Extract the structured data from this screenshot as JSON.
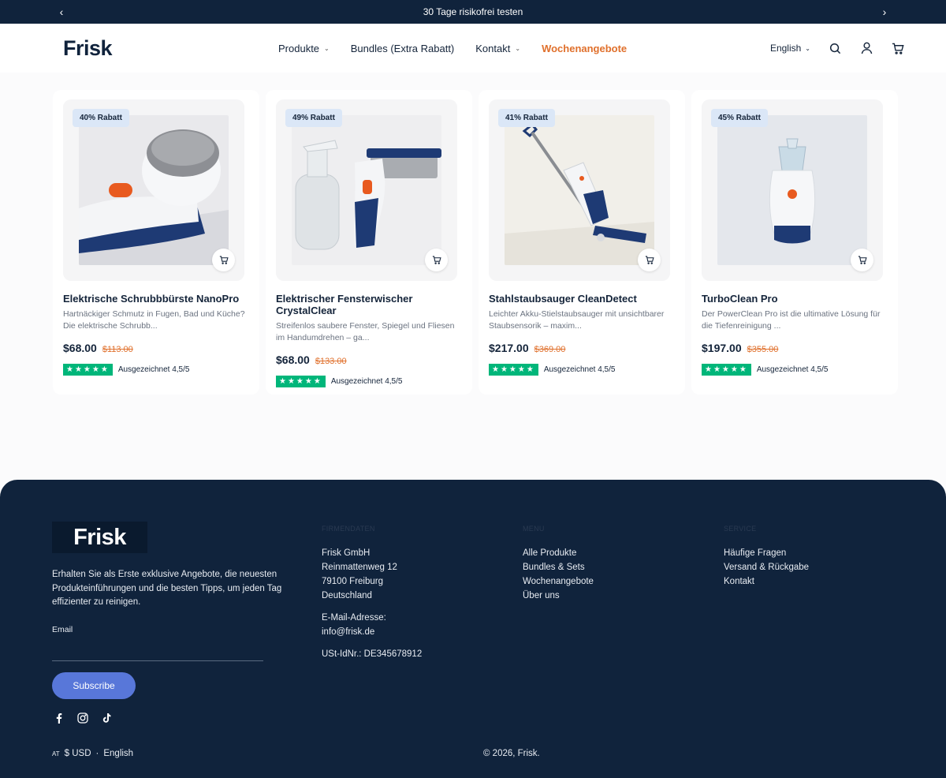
{
  "announcement": {
    "text": "30 Tage risikofrei testen",
    "prev": "‹",
    "next": "›"
  },
  "header": {
    "logo": "Frisk",
    "nav": [
      {
        "label": "Produkte",
        "chevron": "⌄"
      },
      {
        "label": "Bundles (Extra Rabatt)"
      },
      {
        "label": "Kontakt",
        "chevron": "⌄"
      },
      {
        "label": "Wochenangebote"
      }
    ],
    "language": "English",
    "language_chevron": "⌄"
  },
  "products": [
    {
      "badge": "40% Rabatt",
      "title": "Elektrische Schrubbbürste NanoPro",
      "desc": "Hartnäckiger Schmutz in Fugen, Bad und Küche? Die elektrische Schrubb...",
      "price": "$68.00",
      "old_price": "$113.00",
      "stars": "★★★★★",
      "rating": "Ausgezeichnet 4,5/5"
    },
    {
      "badge": "49% Rabatt",
      "title": "Elektrischer Fensterwischer CrystalClear",
      "desc": "Streifenlos saubere Fenster, Spiegel und Fliesen im Handumdrehen – ga...",
      "price": "$68.00",
      "old_price": "$133.00",
      "stars": "★★★★★",
      "rating": "Ausgezeichnet 4,5/5"
    },
    {
      "badge": "41% Rabatt",
      "title": "Stahlstaubsauger CleanDetect",
      "desc": "Leichter Akku-Stielstaubsauger mit unsichtbarer Staubsensorik – maxim...",
      "price": "$217.00",
      "old_price": "$369.00",
      "stars": "★★★★★",
      "rating": "Ausgezeichnet 4,5/5"
    },
    {
      "badge": "45% Rabatt",
      "title": "TurboClean Pro",
      "desc": "Der PowerClean Pro ist die ultimative Lösung für die Tiefenreinigung ...",
      "price": "$197.00",
      "old_price": "$355.00",
      "stars": "★★★★★",
      "rating": "Ausgezeichnet 4,5/5"
    }
  ],
  "footer": {
    "logo": "Frisk",
    "tagline": "Erhalten Sie als Erste exklusive Angebote, die neuesten Produkteinführungen und die besten Tipps, um jeden Tag effizienter zu reinigen.",
    "email_label": "Email",
    "subscribe": "Subscribe",
    "company": {
      "heading": "FIRMENDATEN",
      "lines": [
        "Frisk GmbH",
        "Reinmattenweg 12",
        "79100 Freiburg",
        "Deutschland"
      ],
      "email_label": "E-Mail-Adresse:",
      "email": "info@frisk.de",
      "vat": "USt-IdNr.: DE345678912"
    },
    "menu": {
      "heading": "MENU",
      "links": [
        "Alle Produkte",
        "Bundles & Sets",
        "Wochenangebote",
        "Über uns"
      ]
    },
    "service": {
      "heading": "SERVICE",
      "links": [
        "Häufige Fragen",
        "Versand & Rückgabe",
        "Kontakt"
      ]
    },
    "bottom": {
      "country": "AT",
      "currency": "$ USD",
      "separator": "·",
      "language": "English"
    },
    "copyright": "© 2026, Frisk."
  }
}
